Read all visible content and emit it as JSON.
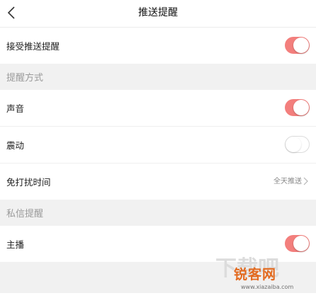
{
  "header": {
    "title": "推送提醒",
    "back_icon": "chevron-left-icon"
  },
  "rows": {
    "accept_push": {
      "label": "接受推送提醒",
      "enabled": true
    },
    "sound": {
      "label": "声音",
      "enabled": true
    },
    "vibrate": {
      "label": "震动",
      "enabled": false
    },
    "dnd": {
      "label": "免打扰时间",
      "value": "全天推送"
    },
    "anchor": {
      "label": "主播",
      "enabled": true
    }
  },
  "sections": {
    "reminder_method": "提醒方式",
    "private_message": "私信提醒"
  },
  "watermark": {
    "text": "锐客网",
    "url": "www.xiazaiba.com"
  },
  "colors": {
    "accent": "#f37f7d",
    "section_bg": "#f1f1f1"
  }
}
